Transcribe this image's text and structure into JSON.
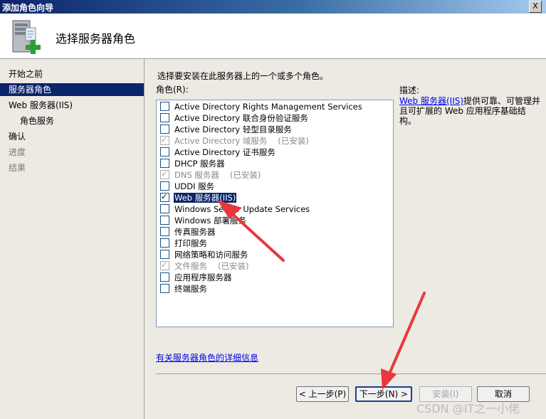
{
  "window": {
    "title": "添加角色向导",
    "close_label": "X"
  },
  "header": {
    "title": "选择服务器角色"
  },
  "nav": {
    "items": [
      {
        "label": "开始之前",
        "state": "normal"
      },
      {
        "label": "服务器角色",
        "state": "active"
      },
      {
        "label": "Web 服务器(IIS)",
        "state": "normal"
      },
      {
        "label": "角色服务",
        "state": "sub"
      },
      {
        "label": "确认",
        "state": "normal"
      },
      {
        "label": "进度",
        "state": "disabled"
      },
      {
        "label": "结果",
        "state": "disabled"
      }
    ]
  },
  "main": {
    "instruction": "选择要安装在此服务器上的一个或多个角色。",
    "roles_label": "角色(R):",
    "roles": [
      {
        "label": "Active Directory Rights Management Services",
        "checked": false,
        "disabled": false,
        "tag": ""
      },
      {
        "label": "Active Directory 联合身份验证服务",
        "checked": false,
        "disabled": false,
        "tag": ""
      },
      {
        "label": "Active Directory 轻型目录服务",
        "checked": false,
        "disabled": false,
        "tag": ""
      },
      {
        "label": "Active Directory 域服务",
        "checked": true,
        "disabled": true,
        "tag": "(已安装)"
      },
      {
        "label": "Active Directory 证书服务",
        "checked": false,
        "disabled": false,
        "tag": ""
      },
      {
        "label": "DHCP 服务器",
        "checked": false,
        "disabled": false,
        "tag": ""
      },
      {
        "label": "DNS 服务器",
        "checked": true,
        "disabled": true,
        "tag": "(已安装)"
      },
      {
        "label": "UDDI 服务",
        "checked": false,
        "disabled": false,
        "tag": ""
      },
      {
        "label": "Web 服务器(IIS)",
        "checked": true,
        "disabled": false,
        "tag": "",
        "selected": true
      },
      {
        "label": "Windows Server Update Services",
        "checked": false,
        "disabled": false,
        "tag": ""
      },
      {
        "label": "Windows 部署服务",
        "checked": false,
        "disabled": false,
        "tag": ""
      },
      {
        "label": "传真服务器",
        "checked": false,
        "disabled": false,
        "tag": ""
      },
      {
        "label": "打印服务",
        "checked": false,
        "disabled": false,
        "tag": ""
      },
      {
        "label": "网络策略和访问服务",
        "checked": false,
        "disabled": false,
        "tag": ""
      },
      {
        "label": "文件服务",
        "checked": true,
        "disabled": true,
        "tag": "(已安装)"
      },
      {
        "label": "应用程序服务器",
        "checked": false,
        "disabled": false,
        "tag": ""
      },
      {
        "label": "终端服务",
        "checked": false,
        "disabled": false,
        "tag": ""
      }
    ],
    "description_label": "描述:",
    "description_link": "Web 服务器(IIS)",
    "description_text": "提供可靠、可管理并且可扩展的 Web 应用程序基础结构。",
    "more_info_link": "有关服务器角色的详细信息"
  },
  "buttons": {
    "back": "< 上一步(P)",
    "next": "下一步(N) >",
    "install": "安装(I)",
    "cancel": "取消"
  },
  "watermark": "CSDN @IT之一小佬",
  "colors": {
    "selection": "#0a246a",
    "annotation_arrow": "#e8383d",
    "panel_bg": "#eceae3"
  }
}
